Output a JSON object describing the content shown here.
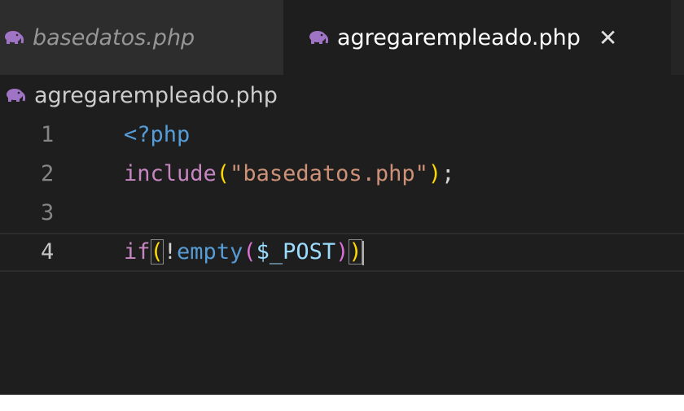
{
  "tabs": [
    {
      "label": "basedatos.php",
      "icon": "php-elephant-icon",
      "active": false
    },
    {
      "label": "agregarempleado.php",
      "icon": "php-elephant-icon",
      "active": true,
      "close_glyph": "✕"
    }
  ],
  "breadcrumb": {
    "file": "agregarempleado.php",
    "icon": "php-elephant-icon"
  },
  "editor": {
    "lines": [
      {
        "number": "1",
        "text": "<?php"
      },
      {
        "number": "2",
        "text": "include(\"basedatos.php\");"
      },
      {
        "number": "3",
        "text": ""
      },
      {
        "number": "4",
        "text": "if(!empty($_POST))"
      }
    ],
    "tokens": {
      "l1_open": "<?php",
      "l2_include": "include",
      "l2_lparen": "(",
      "l2_string": "\"basedatos.php\"",
      "l2_rparen": ")",
      "l2_semi": ";",
      "l4_if": "if",
      "l4_lparen": "(",
      "l4_not": "!",
      "l4_empty": "empty",
      "l4_lparen2": "(",
      "l4_var": "$_POST",
      "l4_rparen2": ")",
      "l4_rparen": ")"
    },
    "current_line": "4"
  },
  "colors": {
    "editor_bg": "#1e1e1e",
    "tab_inactive_bg": "#2d2d2d",
    "keyword_blue": "#569cd6",
    "string": "#ce9178",
    "bracket_gold": "#ffd700",
    "php_icon": "#a074c4"
  }
}
